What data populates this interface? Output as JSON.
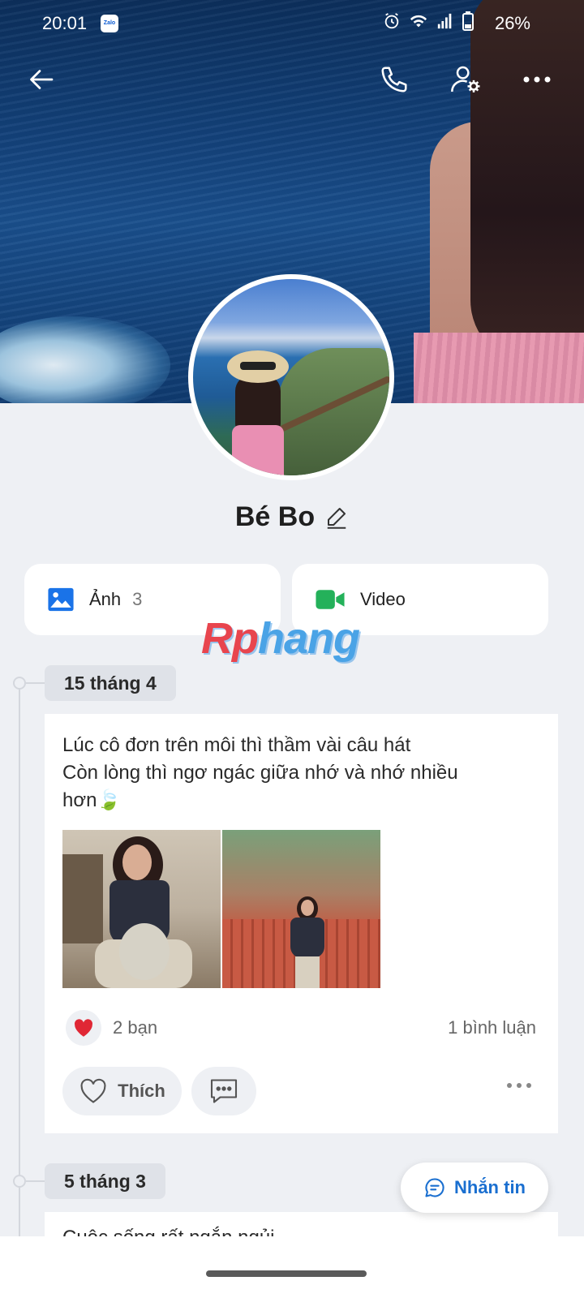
{
  "status_bar": {
    "time": "20:01",
    "app_badge": "Zalo",
    "battery": "26%",
    "icons": [
      "alarm-icon",
      "wifi-icon",
      "signal-icon",
      "battery-icon"
    ]
  },
  "topbar": {
    "icons": [
      "back-arrow-icon",
      "phone-icon",
      "user-settings-icon",
      "more-icon"
    ]
  },
  "profile": {
    "name": "Bé Bo"
  },
  "media": {
    "photos_label": "Ảnh",
    "photos_count": "3",
    "video_label": "Video"
  },
  "watermark": {
    "part1": "Rp",
    "part2": "hang"
  },
  "timeline": [
    {
      "date": "15 tháng 4",
      "text_lines": [
        "Lúc cô đơn trên môi thì thầm vài câu hát",
        "Còn lòng thì ngơ ngác giữa nhớ và nhớ nhiều",
        "hơn🍃"
      ],
      "likes": "2 bạn",
      "comments": "1 bình luận",
      "like_label": "Thích"
    },
    {
      "date": "5 tháng 3",
      "text_preview": "Cuộc sống rất ngắn ngủi"
    }
  ],
  "message_button": {
    "label": "Nhắn tin"
  },
  "colors": {
    "accent": "#1a6fd0",
    "photo_icon": "#1a73e8",
    "video_icon": "#24b15a",
    "heart": "#e02735"
  }
}
